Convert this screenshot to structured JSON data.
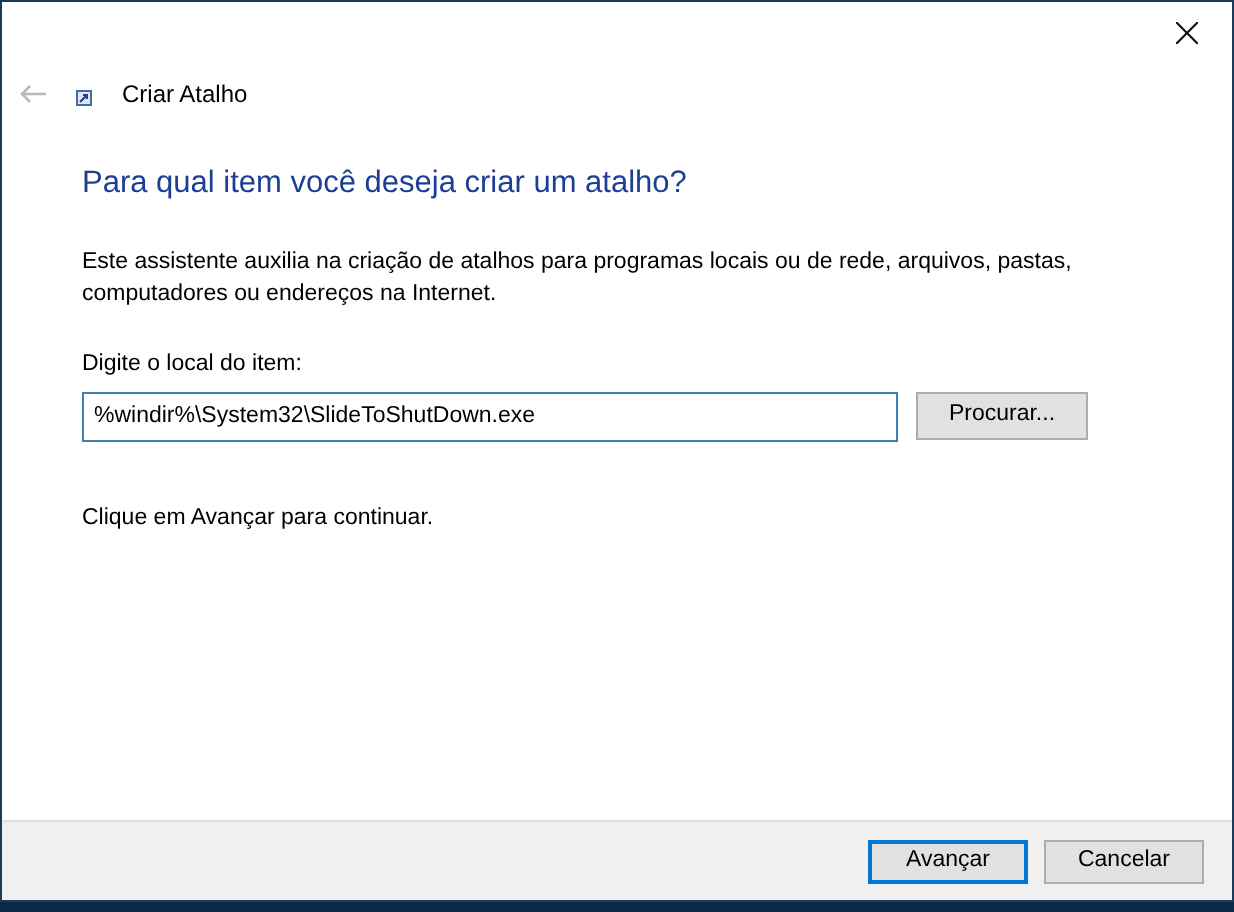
{
  "window": {
    "title": "Criar Atalho"
  },
  "heading": "Para qual item você deseja criar um atalho?",
  "description": "Este assistente auxilia na criação de atalhos para programas locais ou de rede, arquivos, pastas, computadores ou endereços na Internet.",
  "location": {
    "label": "Digite o local do item:",
    "value": "%windir%\\System32\\SlideToShutDown.exe",
    "browse_button": "Procurar..."
  },
  "hint": "Clique em Avançar para continuar.",
  "buttons": [
    {
      "label": "Avançar",
      "default": true
    },
    {
      "label": "Cancelar",
      "default": false
    }
  ]
}
